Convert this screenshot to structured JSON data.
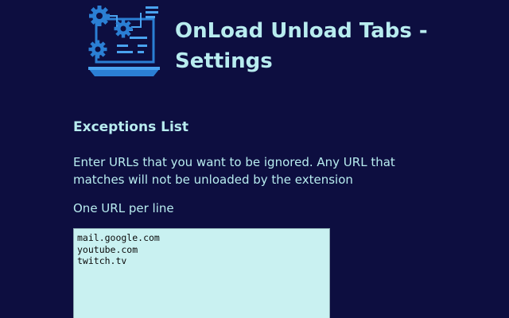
{
  "header": {
    "title": "OnLoad Unload Tabs - Settings",
    "logo_icon": "laptop-gears-logo-icon"
  },
  "exceptions": {
    "heading": "Exceptions List",
    "description": "Enter URLs that you want to be ignored. Any URL that matches will not be unloaded by the extension",
    "hint": "One URL per line",
    "urls_value": "mail.google.com\nyoutube.com\ntwitch.tv"
  },
  "colors": {
    "background": "#0d0e40",
    "text": "#b8ecef",
    "textarea_bg": "#c9f1f1",
    "logo_blue": "#2b7fd4",
    "logo_light": "#4aa3f0"
  }
}
